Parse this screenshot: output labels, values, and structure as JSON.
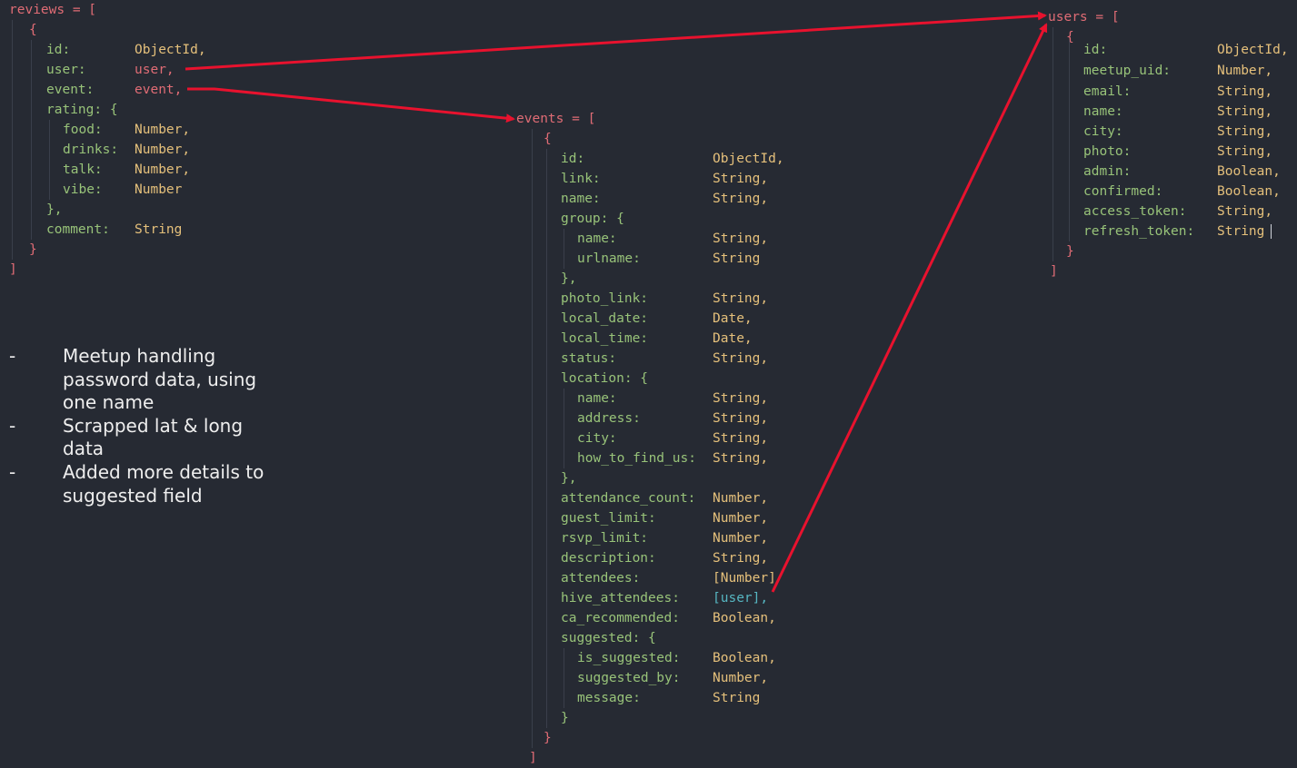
{
  "reviews": {
    "open": "reviews = [",
    "brace_open": "{",
    "fields": [
      {
        "key": "id:",
        "value": "ObjectId,",
        "ref": false
      },
      {
        "key": "user:",
        "value": "user,",
        "ref": true
      },
      {
        "key": "event:",
        "value": "event,",
        "ref": true
      },
      {
        "key": "rating: {",
        "value": "",
        "ref": false
      },
      {
        "key": "food:",
        "value": "Number,",
        "ref": false
      },
      {
        "key": "drinks:",
        "value": "Number,",
        "ref": false
      },
      {
        "key": "talk:",
        "value": "Number,",
        "ref": false
      },
      {
        "key": "vibe:",
        "value": "Number",
        "ref": false
      },
      {
        "key": "},",
        "value": "",
        "ref": false
      },
      {
        "key": "comment:",
        "value": "String",
        "ref": false
      }
    ],
    "brace_close": "}",
    "close": "]"
  },
  "events": {
    "open": "events = [",
    "brace_open": "{",
    "fields": [
      {
        "key": "id:",
        "value": "ObjectId,"
      },
      {
        "key": "link:",
        "value": "String,"
      },
      {
        "key": "name:",
        "value": "String,"
      },
      {
        "key": "group: {",
        "value": ""
      },
      {
        "key": "name:",
        "value": "String,"
      },
      {
        "key": "urlname:",
        "value": "String"
      },
      {
        "key": "},",
        "value": ""
      },
      {
        "key": "photo_link:",
        "value": "String,"
      },
      {
        "key": "local_date:",
        "value": "Date,"
      },
      {
        "key": "local_time:",
        "value": "Date,"
      },
      {
        "key": "status:",
        "value": "String,"
      },
      {
        "key": "location: {",
        "value": ""
      },
      {
        "key": "name:",
        "value": "String,"
      },
      {
        "key": "address:",
        "value": "String,"
      },
      {
        "key": "city:",
        "value": "String,"
      },
      {
        "key": "how_to_find_us:",
        "value": "String,"
      },
      {
        "key": "},",
        "value": ""
      },
      {
        "key": "attendance_count:",
        "value": "Number,"
      },
      {
        "key": "guest_limit:",
        "value": "Number,"
      },
      {
        "key": "rsvp_limit:",
        "value": "Number,"
      },
      {
        "key": "description:",
        "value": "String,"
      },
      {
        "key": "attendees:",
        "value": "[Number]"
      },
      {
        "key": "hive_attendees:",
        "value": "[user],"
      },
      {
        "key": "ca_recommended:",
        "value": "Boolean,"
      },
      {
        "key": "suggested: {",
        "value": ""
      },
      {
        "key": "is_suggested:",
        "value": "Boolean,"
      },
      {
        "key": "suggested_by:",
        "value": "Number,"
      },
      {
        "key": "message:",
        "value": "String"
      },
      {
        "key": "}",
        "value": ""
      }
    ],
    "brace_close": "}",
    "close": "]"
  },
  "users": {
    "open": "users = [",
    "brace_open": "{",
    "fields": [
      {
        "key": "id:",
        "value": "ObjectId,"
      },
      {
        "key": "meetup_uid:",
        "value": "Number,"
      },
      {
        "key": "email:",
        "value": "String,"
      },
      {
        "key": "name:",
        "value": "String,"
      },
      {
        "key": "city:",
        "value": "String,"
      },
      {
        "key": "photo:",
        "value": "String,"
      },
      {
        "key": "admin:",
        "value": "Boolean,"
      },
      {
        "key": "confirmed:",
        "value": "Boolean,"
      },
      {
        "key": "access_token:",
        "value": "String,"
      },
      {
        "key": "refresh_token:",
        "value": "String"
      }
    ],
    "brace_close": "}",
    "close": "]"
  },
  "notes": {
    "bullet": "-",
    "items": [
      "Meetup handling password data, using one name",
      "Scrapped lat & long data",
      "Added more details to suggested field"
    ]
  },
  "colors": {
    "background": "#262a33",
    "key": "#98c379",
    "type": "#e5c07b",
    "bracket": "#e06c75",
    "arrow": "#e8122e"
  }
}
